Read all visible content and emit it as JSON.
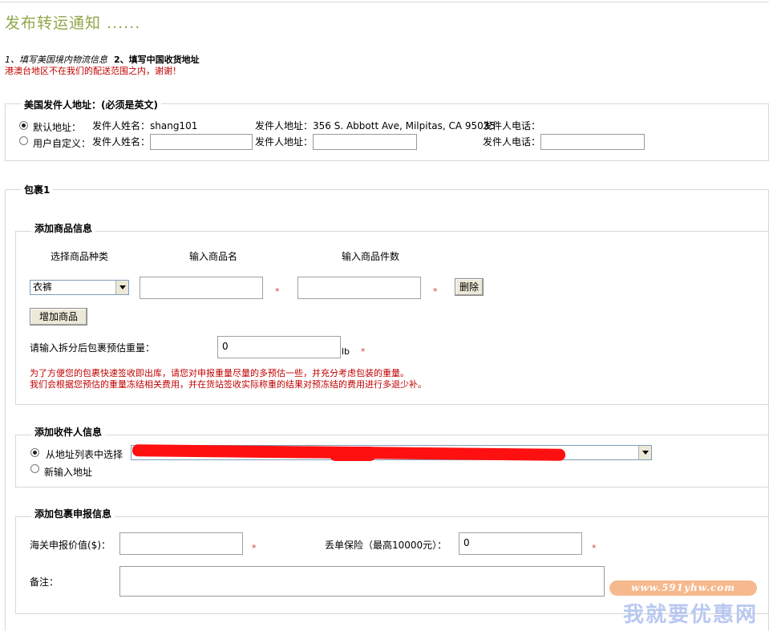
{
  "page": {
    "title": "发布转运通知 ......",
    "step1": "1、填写美国境内物流信息",
    "step2": "2、填写中国收货地址",
    "notice": "港澳台地区不在我们的配送范围之内，谢谢！"
  },
  "sender": {
    "legend": "美国发件人地址：(必须是英文)",
    "default_option": "默认地址：",
    "custom_option": "用户自定义：",
    "name_label": "发件人姓名：",
    "address_label": "发件人地址：",
    "phone_label": "发件人电话：",
    "default_name": "shang101",
    "default_address": "356 S. Abbott Ave, Milpitas, CA 95035"
  },
  "package": {
    "legend": "包裹1"
  },
  "goods": {
    "legend": "添加商品信息",
    "col_type": "选择商品种类",
    "col_name": "输入商品名",
    "col_qty": "输入商品件数",
    "type_value": "衣裤",
    "delete_button": "删除",
    "add_button": "增加商品",
    "weight_label": "请输入拆分后包裹预估重量：",
    "weight_value": "0",
    "weight_unit": "lb",
    "hint1": "为了方便您的包裹快速签收即出库，请您对申报重量尽量的多预估一些，并充分考虑包装的重量。",
    "hint2": "我们会根据您预估的重量冻结相关费用，并在货站签收实际称重的结果对预冻结的费用进行多退少补。"
  },
  "recipient": {
    "legend": "添加收件人信息",
    "from_list_option": "从地址列表中选择",
    "new_option": "新输入地址"
  },
  "declaration": {
    "legend": "添加包裹申报信息",
    "customs_label": "海关申报价值($)：",
    "insurance_label": "丢单保险（最高10000元）：",
    "insurance_value": "0",
    "note_label": "备注："
  },
  "watermark": {
    "url": "www.591yhw.com",
    "name": "我就要优惠网"
  },
  "colors": {
    "title_green": "#8fa84a",
    "notice_red": "#c00000",
    "required_star": "#d04040"
  }
}
